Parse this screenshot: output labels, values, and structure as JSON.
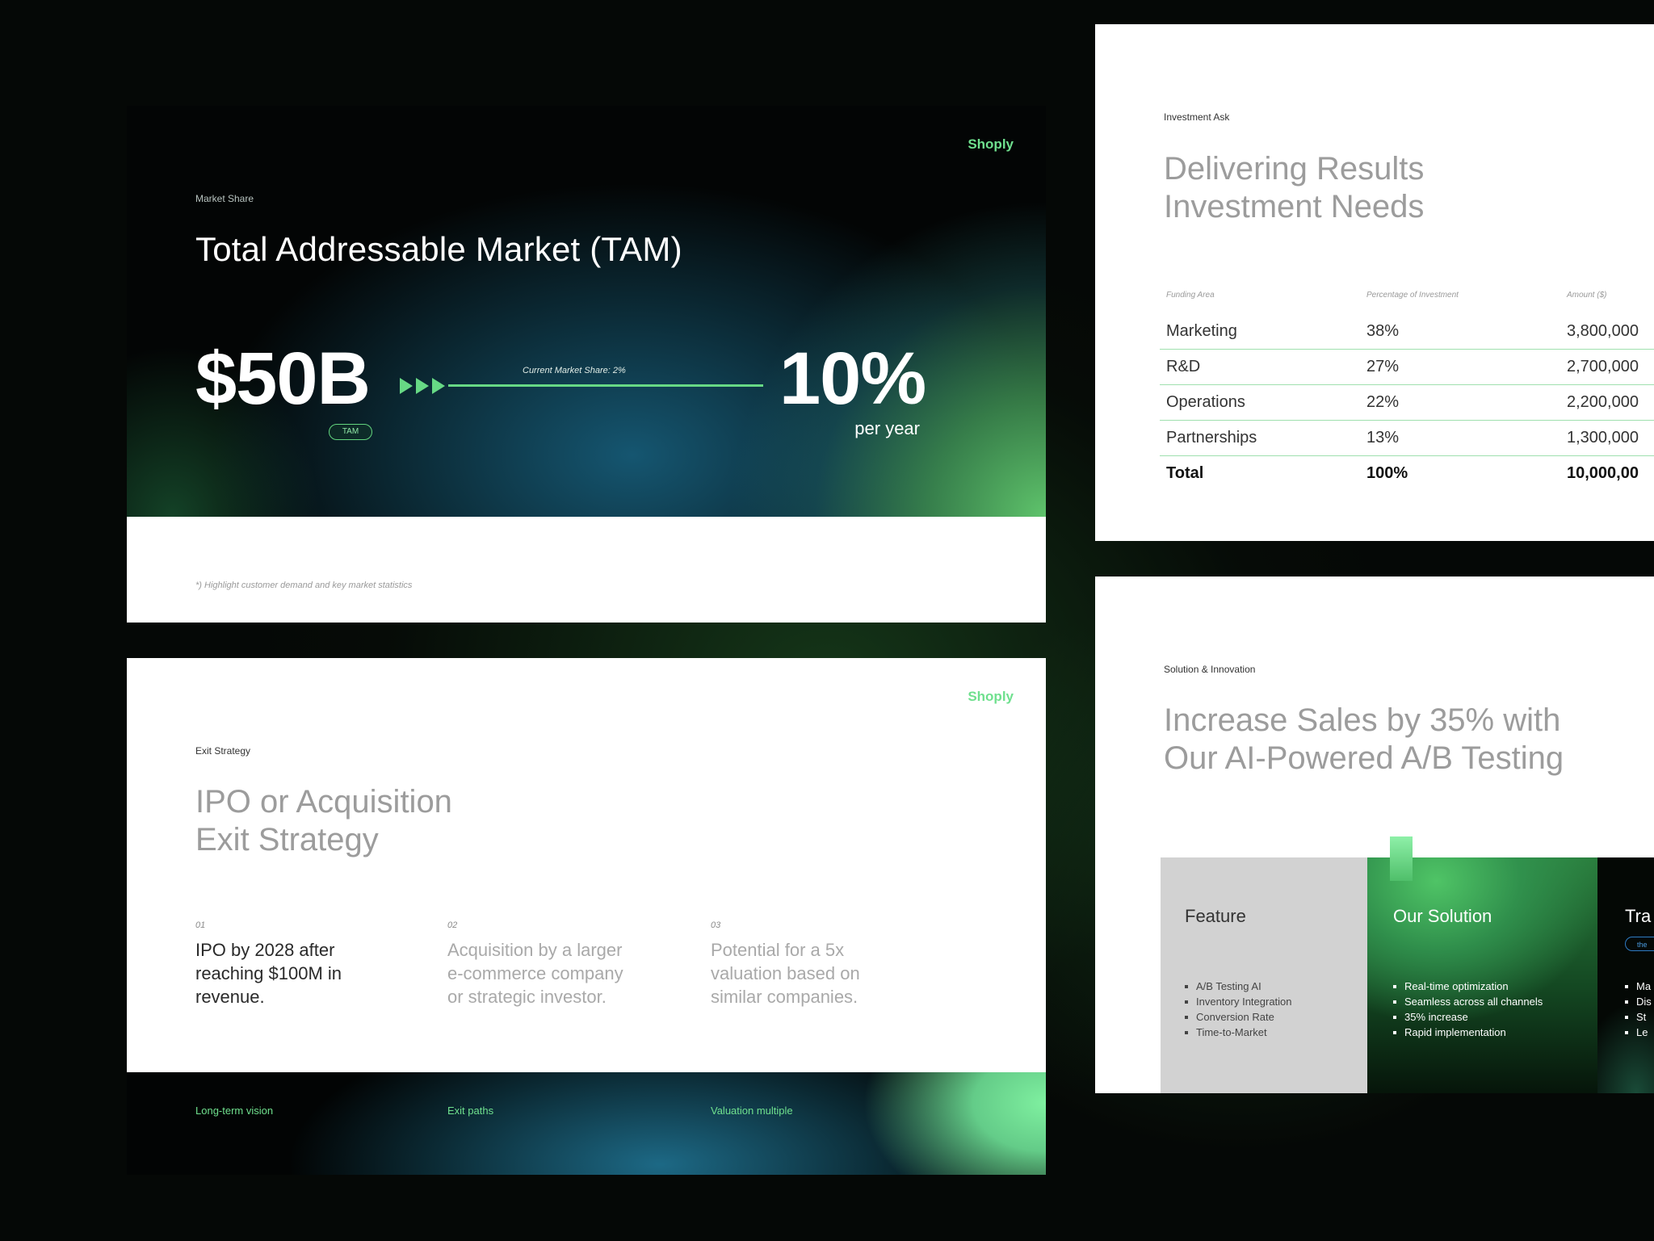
{
  "tam_slide": {
    "brand": "Shoply",
    "kicker": "Market Share",
    "title": "Total Addressable Market (TAM)",
    "tam_value": "$50B",
    "tam_tag": "TAM",
    "share_label": "Current Market Share: 2%",
    "growth_value": "10%",
    "growth_unit": "per year",
    "footnote": "*) Highlight customer demand and key market statistics",
    "accent_color": "#6fe08e"
  },
  "exit_slide": {
    "brand": "Shoply",
    "kicker": "Exit Strategy",
    "title_line1": "IPO or Acquisition",
    "title_line2": "Exit Strategy",
    "columns": [
      {
        "num": "01",
        "text": "IPO by 2028 after reaching $100M in revenue.",
        "label": "Long-term vision"
      },
      {
        "num": "02",
        "text": "Acquisition by a larger e-commerce company or strategic investor.",
        "label": "Exit paths"
      },
      {
        "num": "03",
        "text": "Potential for a 5x valuation based on similar companies.",
        "label": "Valuation multiple"
      }
    ]
  },
  "investment_slide": {
    "kicker": "Investment Ask",
    "title_line1": "Delivering Results",
    "title_line2": "Investment Needs",
    "headers": [
      "Funding Area",
      "Percentage of Investment",
      "Amount ($)"
    ],
    "rows": [
      [
        "Marketing",
        "38%",
        "3,800,000"
      ],
      [
        "R&D",
        "27%",
        "2,700,000"
      ],
      [
        "Operations",
        "22%",
        "2,200,000"
      ],
      [
        "Partnerships",
        "13%",
        "1,300,000"
      ]
    ],
    "total": [
      "Total",
      "100%",
      "10,000,00"
    ]
  },
  "solution_slide": {
    "kicker": "Solution & Innovation",
    "title_line1": "Increase Sales by 35% with",
    "title_line2": "Our AI-Powered A/B Testing",
    "panels": [
      {
        "heading": "Feature",
        "items": [
          "A/B Testing AI",
          "Inventory Integration",
          "Conversion Rate",
          "Time-to-Market"
        ]
      },
      {
        "heading": "Our Solution",
        "items": [
          "Real-time optimization",
          "Seamless across all channels",
          "35% increase",
          "Rapid implementation"
        ]
      },
      {
        "heading": "Tra",
        "pill": "the",
        "items": [
          "Ma",
          "Dis",
          "St",
          "Le"
        ]
      }
    ]
  }
}
